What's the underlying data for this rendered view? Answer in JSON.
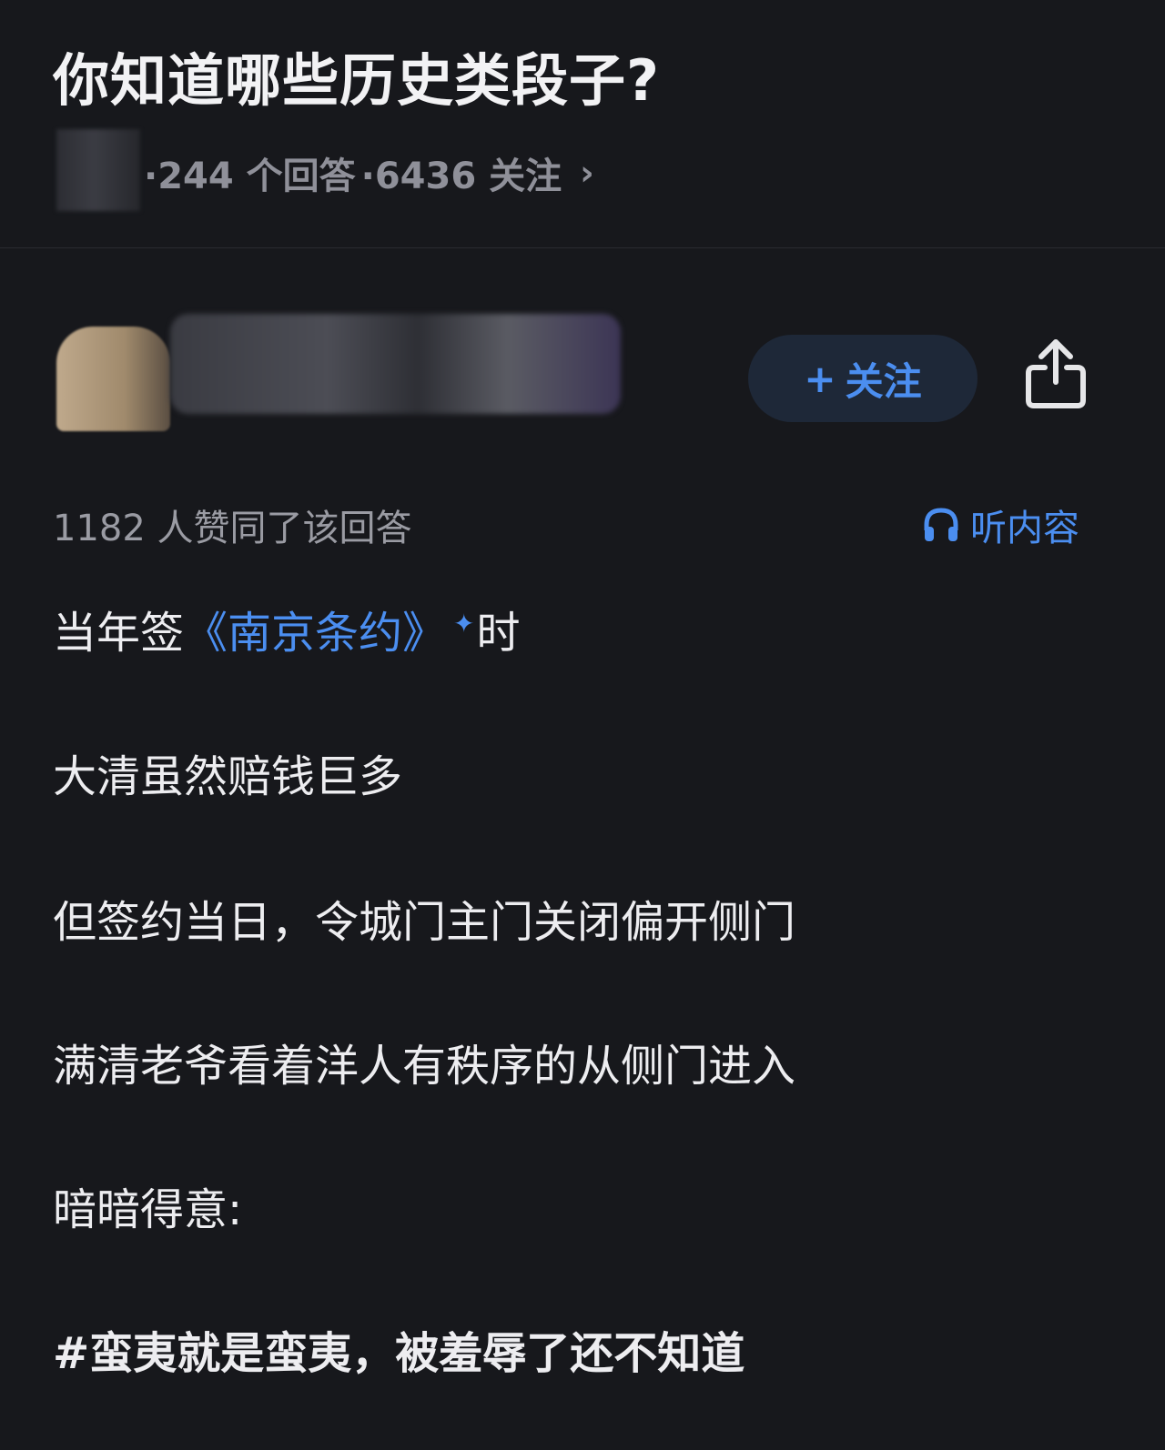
{
  "question": {
    "title": "你知道哪些历史类段子?",
    "answers_count": "·244 个回答",
    "follow_count": "·6436 关注",
    "chevron": "›"
  },
  "author": {
    "follow_button": "关注",
    "follow_plus": "+"
  },
  "answer": {
    "upvote_text": "1182 人赞同了该回答",
    "listen_label": "听内容",
    "paragraphs": {
      "p1_prefix": "当年签",
      "p1_link": "《南京条约》",
      "p1_suffix": "时",
      "p2": "大清虽然赔钱巨多",
      "p3": "但签约当日，令城门主门关闭偏开侧门",
      "p4": "满清老爷看着洋人有秩序的从侧门进入",
      "p5": "暗暗得意:",
      "p6": "#蛮夷就是蛮夷，被羞辱了还不知道"
    }
  },
  "icons": {
    "share": "share-icon",
    "headphones": "headphones-icon",
    "sparkle": "sparkle-icon"
  },
  "colors": {
    "background": "#17181c",
    "accent": "#4b8ef0",
    "muted": "#9a9ba3"
  }
}
